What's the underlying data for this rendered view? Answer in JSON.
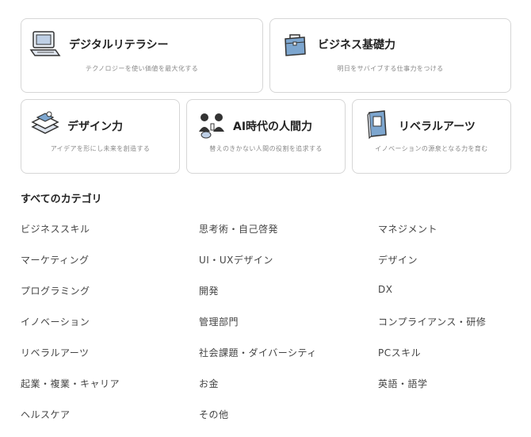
{
  "cards": [
    {
      "title": "デジタルリテラシー",
      "subtitle": "テクノロジーを使い価値を最大化する",
      "icon": "laptop-icon"
    },
    {
      "title": "ビジネス基礎力",
      "subtitle": "明日をサバイブする仕事力をつける",
      "icon": "briefcase-icon"
    },
    {
      "title": "デザイン力",
      "subtitle": "アイデアを形にし未来を創造する",
      "icon": "design-layers-icon"
    },
    {
      "title": "AI時代の人間力",
      "subtitle": "替えのきかない人間の役割を追求する",
      "icon": "people-talking-icon"
    },
    {
      "title": "リベラルアーツ",
      "subtitle": "イノベーションの源泉となる力を育む",
      "icon": "book-icon"
    }
  ],
  "categories_heading": "すべてのカテゴリ",
  "categories": [
    "ビジネススキル",
    "思考術・自己啓発",
    "マネジメント",
    "マーケティング",
    "UI・UXデザイン",
    "デザイン",
    "プログラミング",
    "開発",
    "DX",
    "イノベーション",
    "管理部門",
    "コンプライアンス・研修",
    "リベラルアーツ",
    "社会課題・ダイバーシティ",
    "PCスキル",
    "起業・複業・キャリア",
    "お金",
    "英語・語学",
    "ヘルスケア",
    "その他"
  ]
}
